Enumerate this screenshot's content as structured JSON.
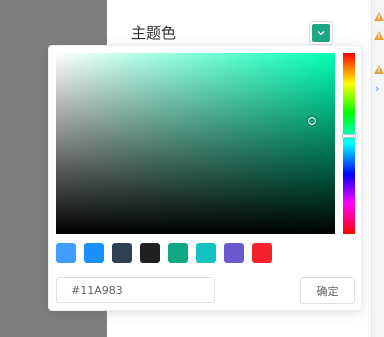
{
  "setting": {
    "theme_color_label": "主题色"
  },
  "current_color": "#1FA785",
  "picker": {
    "hue_color": "#00ffb3",
    "hue_fraction": 0.46,
    "hex_value": "#11A983",
    "confirm_label": "确定",
    "presets": [
      "#409EFF",
      "#1890FF",
      "#304156",
      "#212121",
      "#11A983",
      "#13C2C2",
      "#6959CD",
      "#F5222D"
    ]
  },
  "icons": {
    "warning": "warning-icon",
    "chevron": "chevron-right-icon",
    "dropdown": "chevron-down-icon"
  }
}
